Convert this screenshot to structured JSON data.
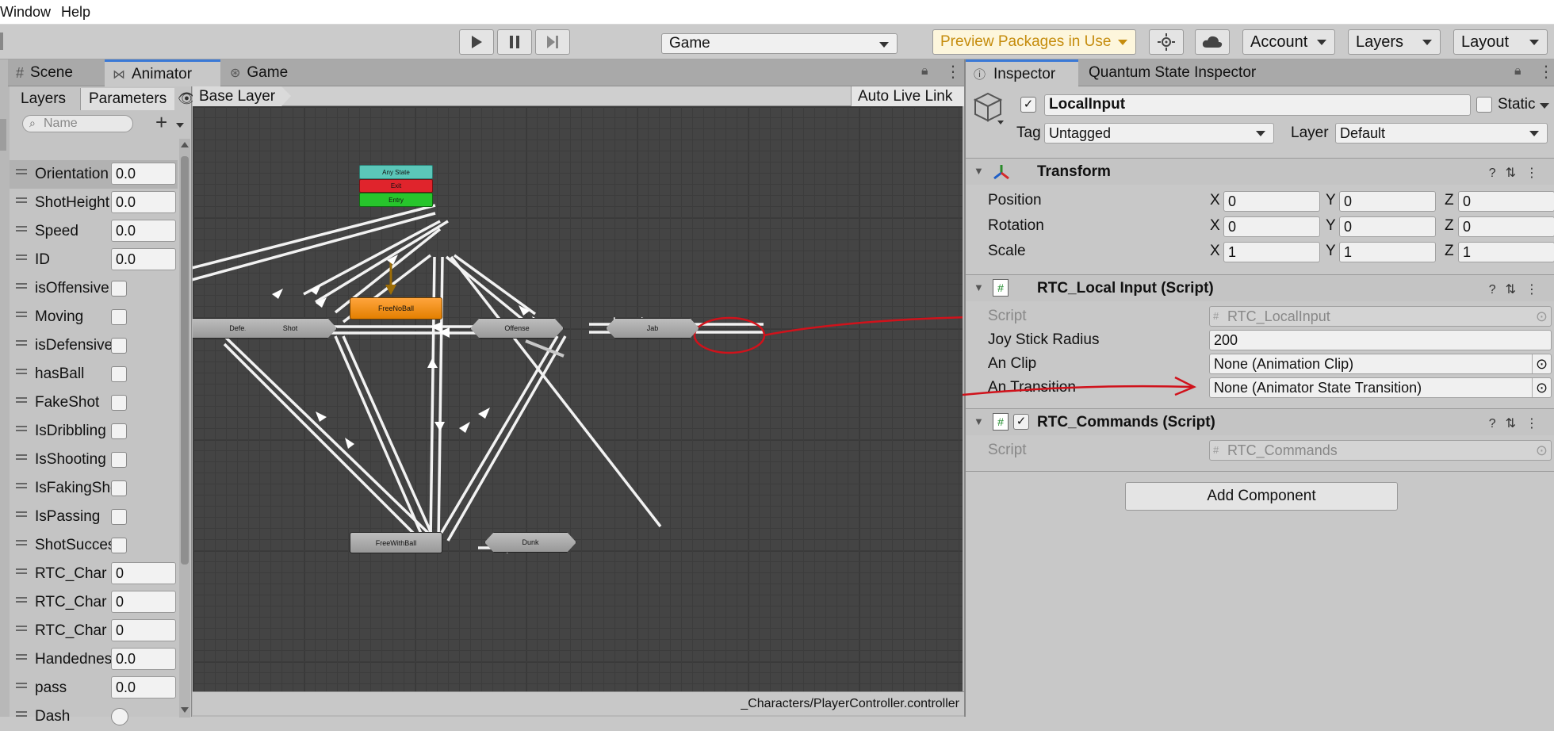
{
  "menubar": {
    "items": [
      "Window",
      "Help"
    ]
  },
  "toolbar": {
    "game_dropdown": "Game",
    "preview_packages": "Preview Packages in Use",
    "account": "Account",
    "layers": "Layers",
    "layout": "Layout",
    "colors": {
      "preview": "#c58c0d"
    }
  },
  "animator_panel": {
    "tabs": [
      "Scene",
      "Animator",
      "Game"
    ],
    "subtabs": [
      "Layers",
      "Parameters"
    ],
    "search_placeholder": "Name",
    "breadcrumb": "Base Layer",
    "auto_live_link": "Auto Live Link",
    "footer_path": "_Characters/PlayerController.controller",
    "parameters": [
      {
        "name": "Orientation",
        "kind": "float",
        "value": "0.0"
      },
      {
        "name": "ShotHeight",
        "kind": "float",
        "value": "0.0"
      },
      {
        "name": "Speed",
        "kind": "float",
        "value": "0.0"
      },
      {
        "name": "ID",
        "kind": "float",
        "value": "0.0"
      },
      {
        "name": "isOffensive",
        "kind": "bool",
        "value": ""
      },
      {
        "name": "Moving",
        "kind": "bool",
        "value": ""
      },
      {
        "name": "isDefensive",
        "kind": "bool",
        "value": ""
      },
      {
        "name": "hasBall",
        "kind": "bool",
        "value": ""
      },
      {
        "name": "FakeShot",
        "kind": "bool",
        "value": ""
      },
      {
        "name": "IsDribbling",
        "kind": "bool",
        "value": ""
      },
      {
        "name": "IsShooting",
        "kind": "bool",
        "value": ""
      },
      {
        "name": "IsFakingShot",
        "kind": "bool",
        "value": ""
      },
      {
        "name": "IsPassing",
        "kind": "bool",
        "value": ""
      },
      {
        "name": "ShotSuccess",
        "kind": "bool",
        "value": ""
      },
      {
        "name": "RTC_Char",
        "kind": "int",
        "value": "0"
      },
      {
        "name": "RTC_Char",
        "kind": "int",
        "value": "0"
      },
      {
        "name": "RTC_Char",
        "kind": "int",
        "value": "0"
      },
      {
        "name": "Handedness",
        "kind": "float",
        "value": "0.0"
      },
      {
        "name": "pass",
        "kind": "float",
        "value": "0.0"
      },
      {
        "name": "Dash",
        "kind": "trigger",
        "value": ""
      }
    ],
    "states": {
      "any_state": "Any State",
      "exit": "Exit",
      "entry": "Entry",
      "free_no_ball": "FreeNoBall",
      "defense": "Defense",
      "shot": "Shot",
      "offense": "Offense",
      "jab": "Jab",
      "free_with_ball": "FreeWithBall",
      "dunk": "Dunk"
    }
  },
  "inspector": {
    "tabs": [
      "Inspector",
      "Quantum State Inspector"
    ],
    "object_name": "LocalInput",
    "static_label": "Static",
    "tag_label": "Tag",
    "tag_value": "Untagged",
    "layer_label": "Layer",
    "layer_value": "Default",
    "transform": {
      "title": "Transform",
      "rows": [
        {
          "label": "Position",
          "x": "0",
          "y": "0",
          "z": "0"
        },
        {
          "label": "Rotation",
          "x": "0",
          "y": "0",
          "z": "0"
        },
        {
          "label": "Scale",
          "x": "1",
          "y": "1",
          "z": "1"
        }
      ],
      "axis_labels": [
        "X",
        "Y",
        "Z"
      ]
    },
    "local_input": {
      "title": "RTC_Local Input (Script)",
      "script_label": "Script",
      "script_value": "RTC_LocalInput",
      "joy_label": "Joy Stick Radius",
      "joy_value": "200",
      "clip_label": "An Clip",
      "clip_value": "None (Animation Clip)",
      "transition_label": "An Transition",
      "transition_value": "None (Animator State Transition)"
    },
    "commands": {
      "title": "RTC_Commands (Script)",
      "script_label": "Script",
      "script_value": "RTC_Commands"
    },
    "add_component": "Add Component"
  }
}
